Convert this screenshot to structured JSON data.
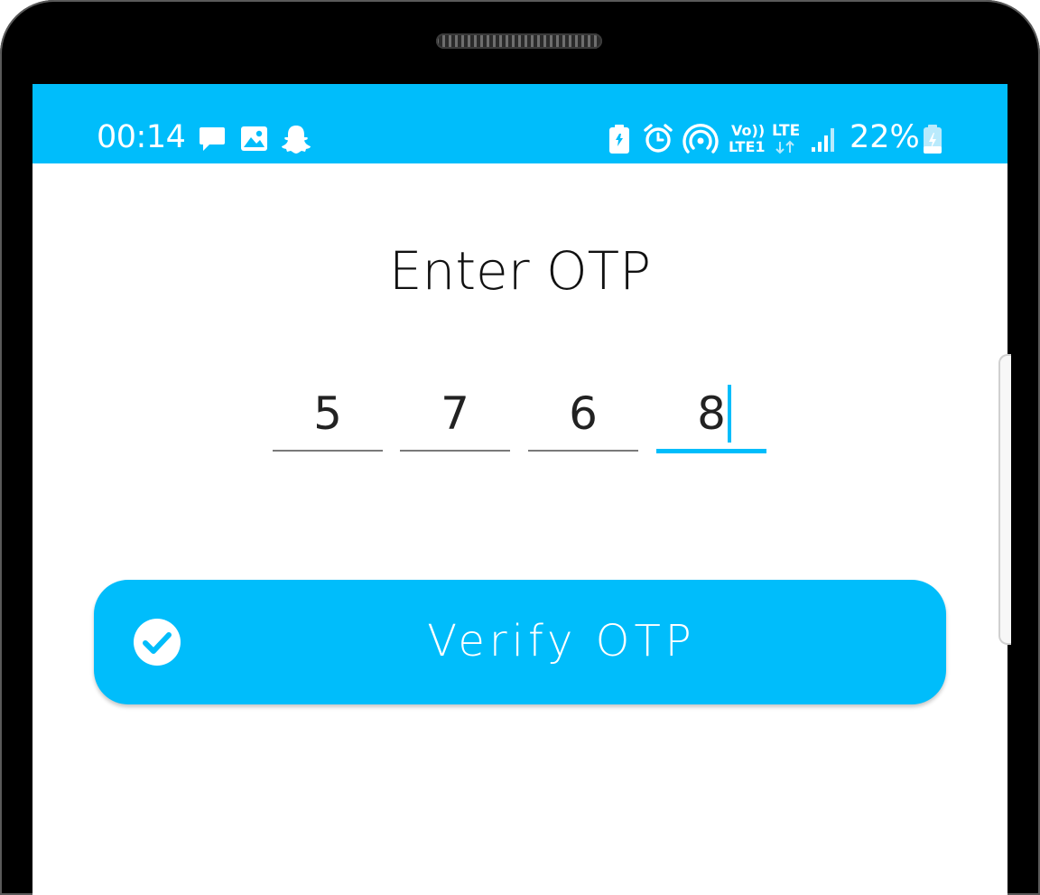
{
  "status_bar": {
    "time": "00:14",
    "volte_text": "Vo))",
    "lte1_text": "LTE1",
    "lte_text": "LTE",
    "battery_percent": "22%",
    "left_icons": [
      "message-icon",
      "image-icon",
      "snapchat-ghost-icon"
    ],
    "right_icons": [
      "battery-saver-icon",
      "alarm-icon",
      "hotspot-icon",
      "signal-icon",
      "battery-charging-icon"
    ],
    "background_color": "#00bdfb"
  },
  "otp": {
    "title": "Enter OTP",
    "digits": [
      "5",
      "7",
      "6",
      "8"
    ],
    "active_index": 3,
    "accent_color": "#00bdfb"
  },
  "verify_button": {
    "label": "Verify OTP",
    "icon": "check-circle-icon",
    "color": "#00bdfb"
  }
}
